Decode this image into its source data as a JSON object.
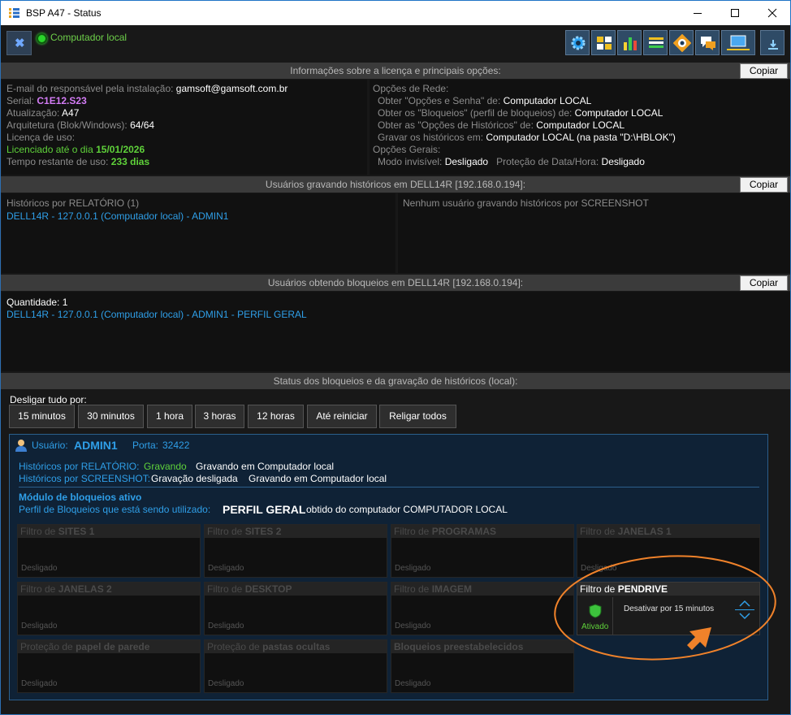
{
  "window": {
    "title": "BSP A47 - Status"
  },
  "toolbar": {
    "status_label": "Computador local",
    "icons": [
      "settings-icon",
      "dashboard-icon",
      "chart-icon",
      "list-icon",
      "monitor-eye-icon",
      "chat-icon",
      "screen-pc-icon",
      "download-icon"
    ]
  },
  "license": {
    "header": "Informações sobre a licença e principais opções:",
    "copy": "Copiar",
    "email_label": "E-mail do responsável pela instalação:",
    "email_value": "gamsoft@gamsoft.com.br",
    "serial_label": "Serial:",
    "serial_value": "C1E12.S23",
    "update_label": "Atualização:",
    "update_value": "A47",
    "arch_label": "Arquitetura (Blok/Windows):",
    "arch_value": "64/64",
    "license_label": "Licença de uso:",
    "licensed_label": "Licenciado até o dia",
    "licensed_value": "15/01/2026",
    "remaining_label": "Tempo restante de uso:",
    "remaining_value": "233 dias",
    "net_title": "Opções de Rede:",
    "opt1_label": "Obter \"Opções e Senha\" de:",
    "opt1_value": "Computador LOCAL",
    "opt2_label": "Obter os \"Bloqueios\" (perfil de bloqueios) de:",
    "opt2_value": "Computador LOCAL",
    "opt3_label": "Obter as \"Opções de Históricos\" de:",
    "opt3_value": "Computador LOCAL",
    "opt4_label": "Gravar os históricos em:",
    "opt4_value": "Computador LOCAL (na pasta \"D:\\HBLOK\")",
    "general_title": "Opções Gerais:",
    "gen1_label": "Modo invisível:",
    "gen1_value": "Desligado",
    "gen2_label": "Proteção de Data/Hora:",
    "gen2_value": "Desligado"
  },
  "recording": {
    "header": "Usuários gravando históricos em DELL14R [192.168.0.194]:",
    "copy": "Copiar",
    "report_title": "Históricos por RELATÓRIO (1)",
    "report_entry": "DELL14R - 127.0.0.1 (Computador local) - ADMIN1",
    "screenshot_text": "Nenhum usuário gravando históricos por SCREENSHOT"
  },
  "blocks": {
    "header": "Usuários obtendo bloqueios em DELL14R [192.168.0.194]:",
    "copy": "Copiar",
    "quantity": "Quantidade: 1",
    "entry": "DELL14R - 127.0.0.1 (Computador local) - ADMIN1 - PERFIL GERAL"
  },
  "status": {
    "header": "Status dos bloqueios e da gravação de históricos (local):",
    "disable_label": "Desligar tudo por:",
    "buttons": [
      "15 minutos",
      "30 minutos",
      "1 hora",
      "3 horas",
      "12 horas",
      "Até reiniciar",
      "Religar todos"
    ]
  },
  "user": {
    "user_label": "Usuário:",
    "user_name": "ADMIN1",
    "port_label": "Porta:",
    "port_value": "32422",
    "report_label": "Históricos por RELATÓRIO:",
    "report_state": "Gravando",
    "report_detail": "Gravando em Computador local",
    "shot_label": "Históricos por SCREENSHOT:",
    "shot_state": "Gravação desligada",
    "shot_detail": "Gravando em Computador local",
    "module_title": "Módulo de bloqueios ativo",
    "profile_label": "Perfil de Bloqueios que está sendo utilizado:",
    "profile_name": "PERFIL GERAL",
    "profile_source": "obtido do computador  COMPUTADOR LOCAL"
  },
  "filters": [
    {
      "prefix": "Filtro de",
      "name": "SITES 1",
      "state": "Desligado"
    },
    {
      "prefix": "Filtro de",
      "name": "SITES 2",
      "state": "Desligado"
    },
    {
      "prefix": "Filtro de",
      "name": "PROGRAMAS",
      "state": "Desligado"
    },
    {
      "prefix": "Filtro de",
      "name": "JANELAS 1",
      "state": "Desligado"
    },
    {
      "prefix": "Filtro de",
      "name": "JANELAS 2",
      "state": "Desligado"
    },
    {
      "prefix": "Filtro de",
      "name": "DESKTOP",
      "state": "Desligado"
    },
    {
      "prefix": "Filtro de",
      "name": "IMAGEM",
      "state": "Desligado"
    },
    {
      "prefix": "Proteção de",
      "name": "papel de parede",
      "state": "Desligado"
    },
    {
      "prefix": "Proteção de",
      "name": "pastas ocultas",
      "state": "Desligado"
    },
    {
      "prefix": "",
      "name": "Bloqueios preestabelecidos",
      "state": "Desligado"
    }
  ],
  "pendrive": {
    "prefix": "Filtro de",
    "name": "PENDRIVE",
    "state": "Ativado",
    "action": "Desativar por 15 minutos"
  },
  "colors": {
    "accent": "#2f9fe8",
    "active": "#6ed04a",
    "annotation": "#f0822a"
  }
}
